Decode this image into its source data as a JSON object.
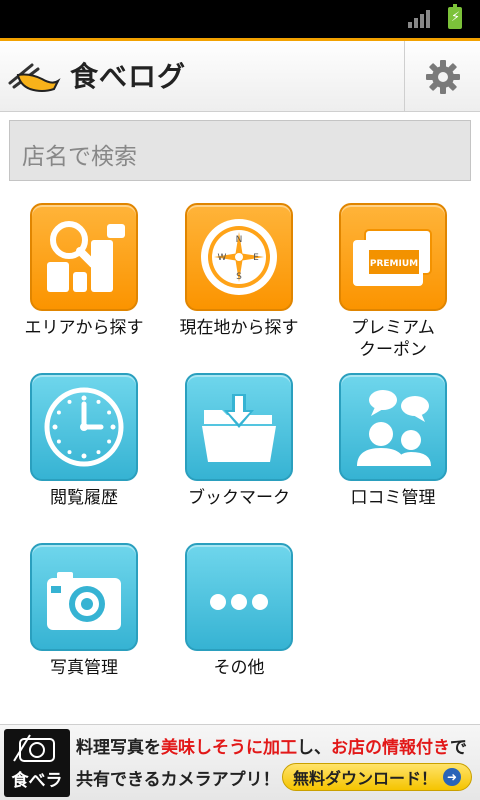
{
  "app": {
    "title": "食べログ"
  },
  "search": {
    "placeholder": "店名で検索"
  },
  "menu": [
    {
      "label": "エリアから探す",
      "icon": "map-search-icon",
      "color": "orange"
    },
    {
      "label": "現在地から探す",
      "icon": "compass-icon",
      "color": "orange"
    },
    {
      "label": "プレミアム\nクーポン",
      "icon": "premium-coupon-icon",
      "color": "orange",
      "icon_text": "PREMIUM"
    },
    {
      "label": "閲覧履歴",
      "icon": "clock-icon",
      "color": "blue"
    },
    {
      "label": "ブックマーク",
      "icon": "folder-download-icon",
      "color": "blue"
    },
    {
      "label": "口コミ管理",
      "icon": "users-chat-icon",
      "color": "blue"
    },
    {
      "label": "写真管理",
      "icon": "camera-icon",
      "color": "blue"
    },
    {
      "label": "その他",
      "icon": "more-icon",
      "color": "blue"
    }
  ],
  "ad": {
    "logo_text": "食べラ",
    "line1_a": "料理写真を",
    "line1_b": "美味しそうに加工",
    "line1_c": "し、",
    "line1_d": "お店の情報付き",
    "line1_e": "で",
    "line2": "共有できるカメラアプリ！",
    "button": "無料ダウンロード！"
  },
  "colors": {
    "accent_orange": "#fb9400",
    "tile_blue": "#36b3d3",
    "ad_red": "#e21818"
  }
}
